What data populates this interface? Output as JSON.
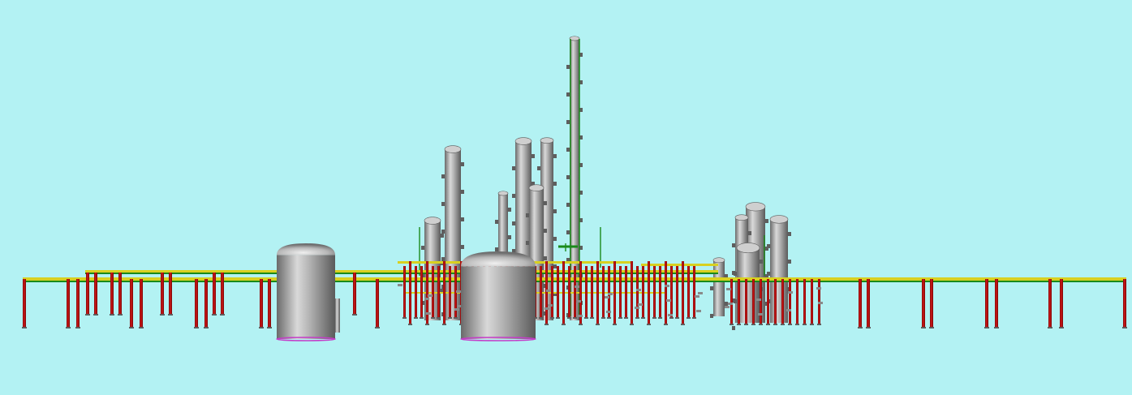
{
  "scene": {
    "description_hidden": "",
    "colors": {
      "background": "#b3f2f3",
      "vessel_light": "#e8e8e8",
      "vessel_mid": "#a6a6a6",
      "vessel_dark": "#5e5e5e",
      "pipe_rack_red": "#b30d0d",
      "pipe_rack_red_dark": "#7a0606",
      "pipe_yellow": "#d8d020",
      "pipe_green": "#1a8a1a",
      "pipe_purple": "#c43cc8",
      "detail_gray": "#8a8a8a"
    }
  }
}
